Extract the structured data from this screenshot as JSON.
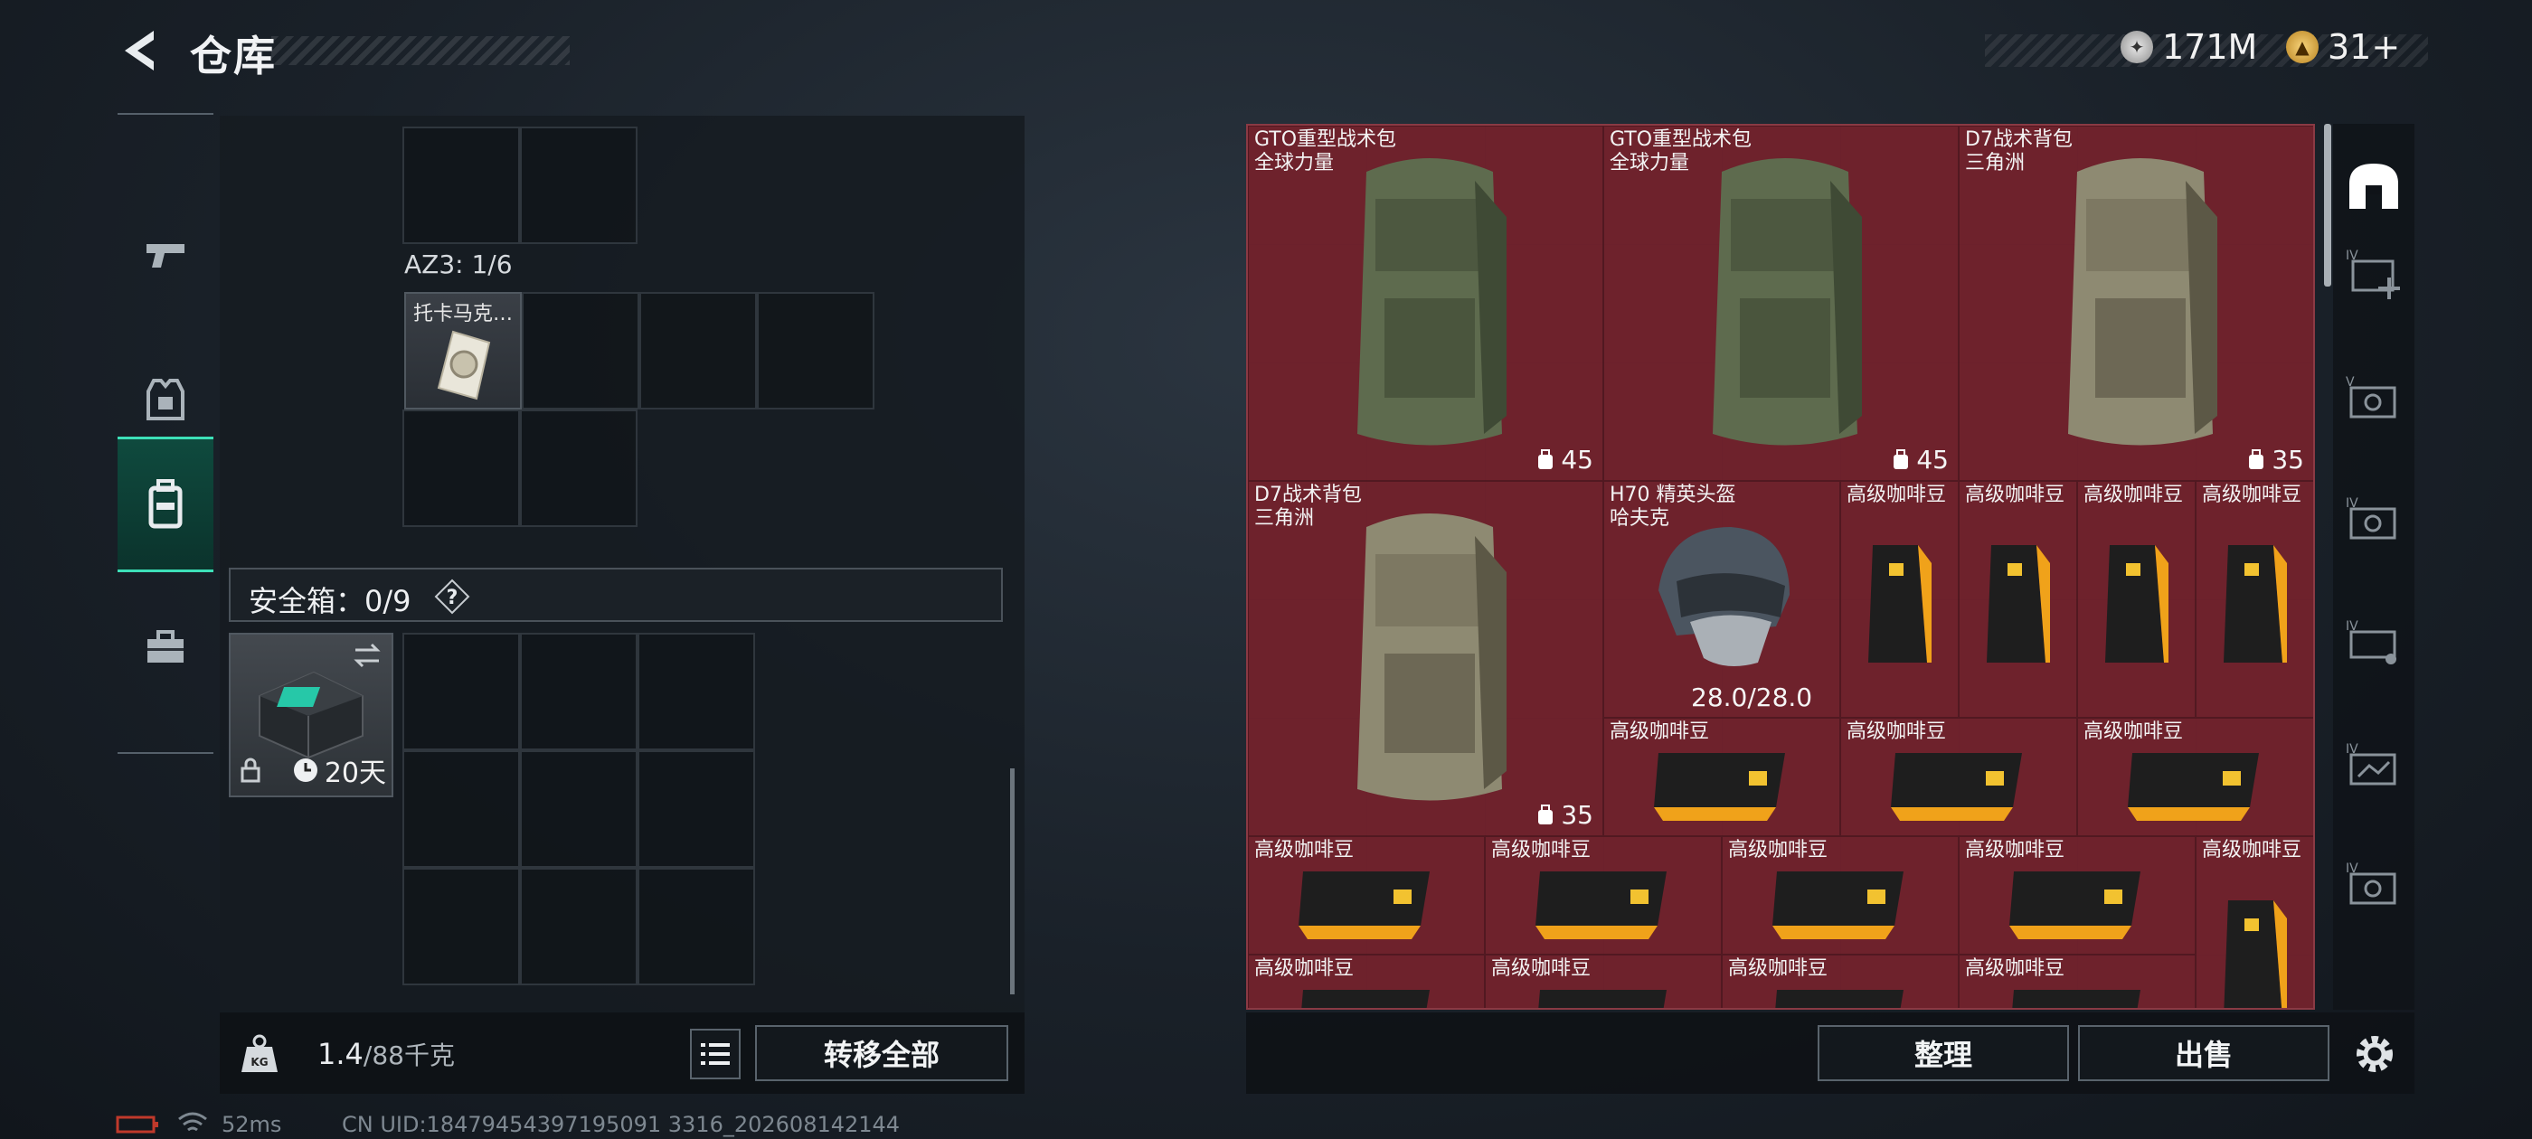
{
  "header": {
    "title": "仓库",
    "silver_amount": "171M",
    "gold_amount": "31+"
  },
  "left": {
    "az3_label": "AZ3: 1/6",
    "az3_item_name": "托卡马克…",
    "safe_box_label": "安全箱：0/9",
    "safe_box_days": "20天",
    "weight_current": "1.4",
    "weight_max": "/88千克",
    "transfer_all_label": "转移全部"
  },
  "right": {
    "items": [
      {
        "name1": "GTO重型战术包",
        "name2": "全球力量",
        "count": "45"
      },
      {
        "name1": "GTO重型战术包",
        "name2": "全球力量",
        "count": "45"
      },
      {
        "name1": "D7战术背包",
        "name2": "三角洲",
        "count": "35"
      },
      {
        "name1": "D7战术背包",
        "name2": "三角洲",
        "count": "35"
      },
      {
        "name1": "H70 精英头盔",
        "name2": "哈夫克",
        "durability": "28.0/28.0"
      }
    ],
    "coffee_name": "高级咖啡豆",
    "sort_label": "整理",
    "sell_label": "出售"
  },
  "status": {
    "ping": "52ms",
    "uid": "CN UID:18479454397195091 3316_202608142144"
  },
  "colors": {
    "accent": "#3de0b8",
    "item_bg": "#6e2730"
  }
}
